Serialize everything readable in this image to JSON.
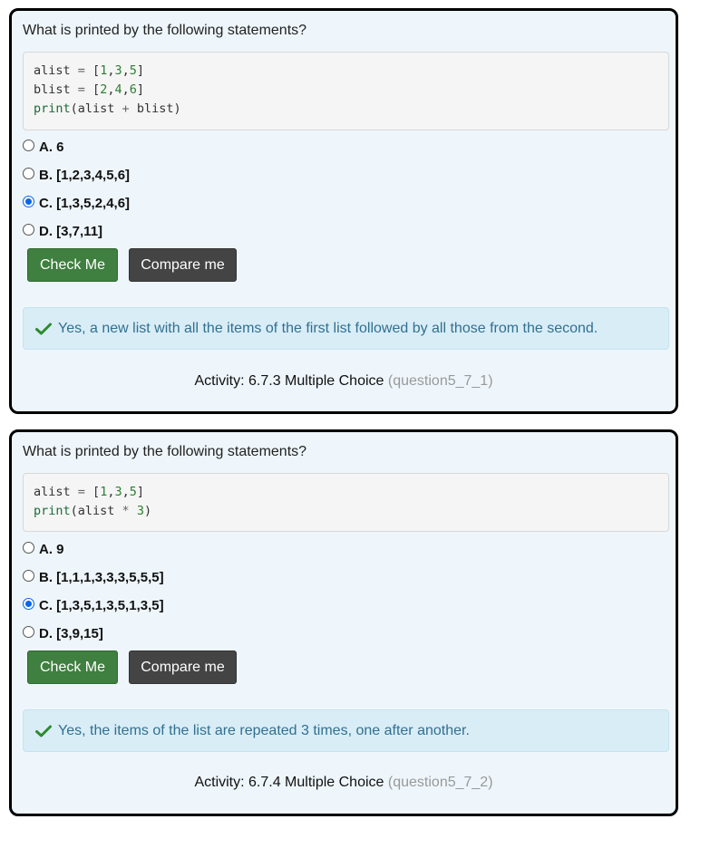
{
  "questions": [
    {
      "prompt": "What is printed by the following statements?",
      "code": [
        [
          {
            "t": "alist ",
            "c": ""
          },
          {
            "t": "= ",
            "c": "op"
          },
          {
            "t": "[",
            "c": ""
          },
          {
            "t": "1",
            "c": "num"
          },
          {
            "t": ",",
            "c": ""
          },
          {
            "t": "3",
            "c": "num"
          },
          {
            "t": ",",
            "c": ""
          },
          {
            "t": "5",
            "c": "num"
          },
          {
            "t": "]",
            "c": ""
          }
        ],
        [
          {
            "t": "blist ",
            "c": ""
          },
          {
            "t": "= ",
            "c": "op"
          },
          {
            "t": "[",
            "c": ""
          },
          {
            "t": "2",
            "c": "num"
          },
          {
            "t": ",",
            "c": ""
          },
          {
            "t": "4",
            "c": "num"
          },
          {
            "t": ",",
            "c": ""
          },
          {
            "t": "6",
            "c": "num"
          },
          {
            "t": "]",
            "c": ""
          }
        ],
        [
          {
            "t": "print",
            "c": "fn"
          },
          {
            "t": "(alist ",
            "c": ""
          },
          {
            "t": "+ ",
            "c": "op"
          },
          {
            "t": "blist)",
            "c": ""
          }
        ]
      ],
      "options": [
        {
          "label": "A. 6",
          "checked": false
        },
        {
          "label": "B. [1,2,3,4,5,6]",
          "checked": false
        },
        {
          "label": "C. [1,3,5,2,4,6]",
          "checked": true
        },
        {
          "label": "D. [3,7,11]",
          "checked": false
        }
      ],
      "check_button": "Check Me",
      "compare_button": "Compare me",
      "feedback": "Yes, a new list with all the items of the first list followed by all those from the second.",
      "activity_label": "Activity: 6.7.3 Multiple Choice",
      "activity_id": "(question5_7_1)"
    },
    {
      "prompt": "What is printed by the following statements?",
      "code": [
        [
          {
            "t": "alist ",
            "c": ""
          },
          {
            "t": "= ",
            "c": "op"
          },
          {
            "t": "[",
            "c": ""
          },
          {
            "t": "1",
            "c": "num"
          },
          {
            "t": ",",
            "c": ""
          },
          {
            "t": "3",
            "c": "num"
          },
          {
            "t": ",",
            "c": ""
          },
          {
            "t": "5",
            "c": "num"
          },
          {
            "t": "]",
            "c": ""
          }
        ],
        [
          {
            "t": "print",
            "c": "fn"
          },
          {
            "t": "(alist ",
            "c": ""
          },
          {
            "t": "* ",
            "c": "op"
          },
          {
            "t": "3",
            "c": "num"
          },
          {
            "t": ")",
            "c": ""
          }
        ]
      ],
      "options": [
        {
          "label": "A. 9",
          "checked": false
        },
        {
          "label": "B. [1,1,1,3,3,3,5,5,5]",
          "checked": false
        },
        {
          "label": "C. [1,3,5,1,3,5,1,3,5]",
          "checked": true
        },
        {
          "label": "D. [3,9,15]",
          "checked": false
        }
      ],
      "check_button": "Check Me",
      "compare_button": "Compare me",
      "feedback": "Yes, the items of the list are repeated 3 times, one after another.",
      "activity_label": "Activity: 6.7.4 Multiple Choice",
      "activity_id": "(question5_7_2)"
    }
  ],
  "colors": {
    "check_button": "#3f7f3f",
    "compare_button": "#444444",
    "feedback_bg": "#d9edf7",
    "feedback_icon": "#2e8b2e",
    "radio_selected": "#0a66e6"
  },
  "icons": {
    "feedback": "checkmark-icon"
  }
}
